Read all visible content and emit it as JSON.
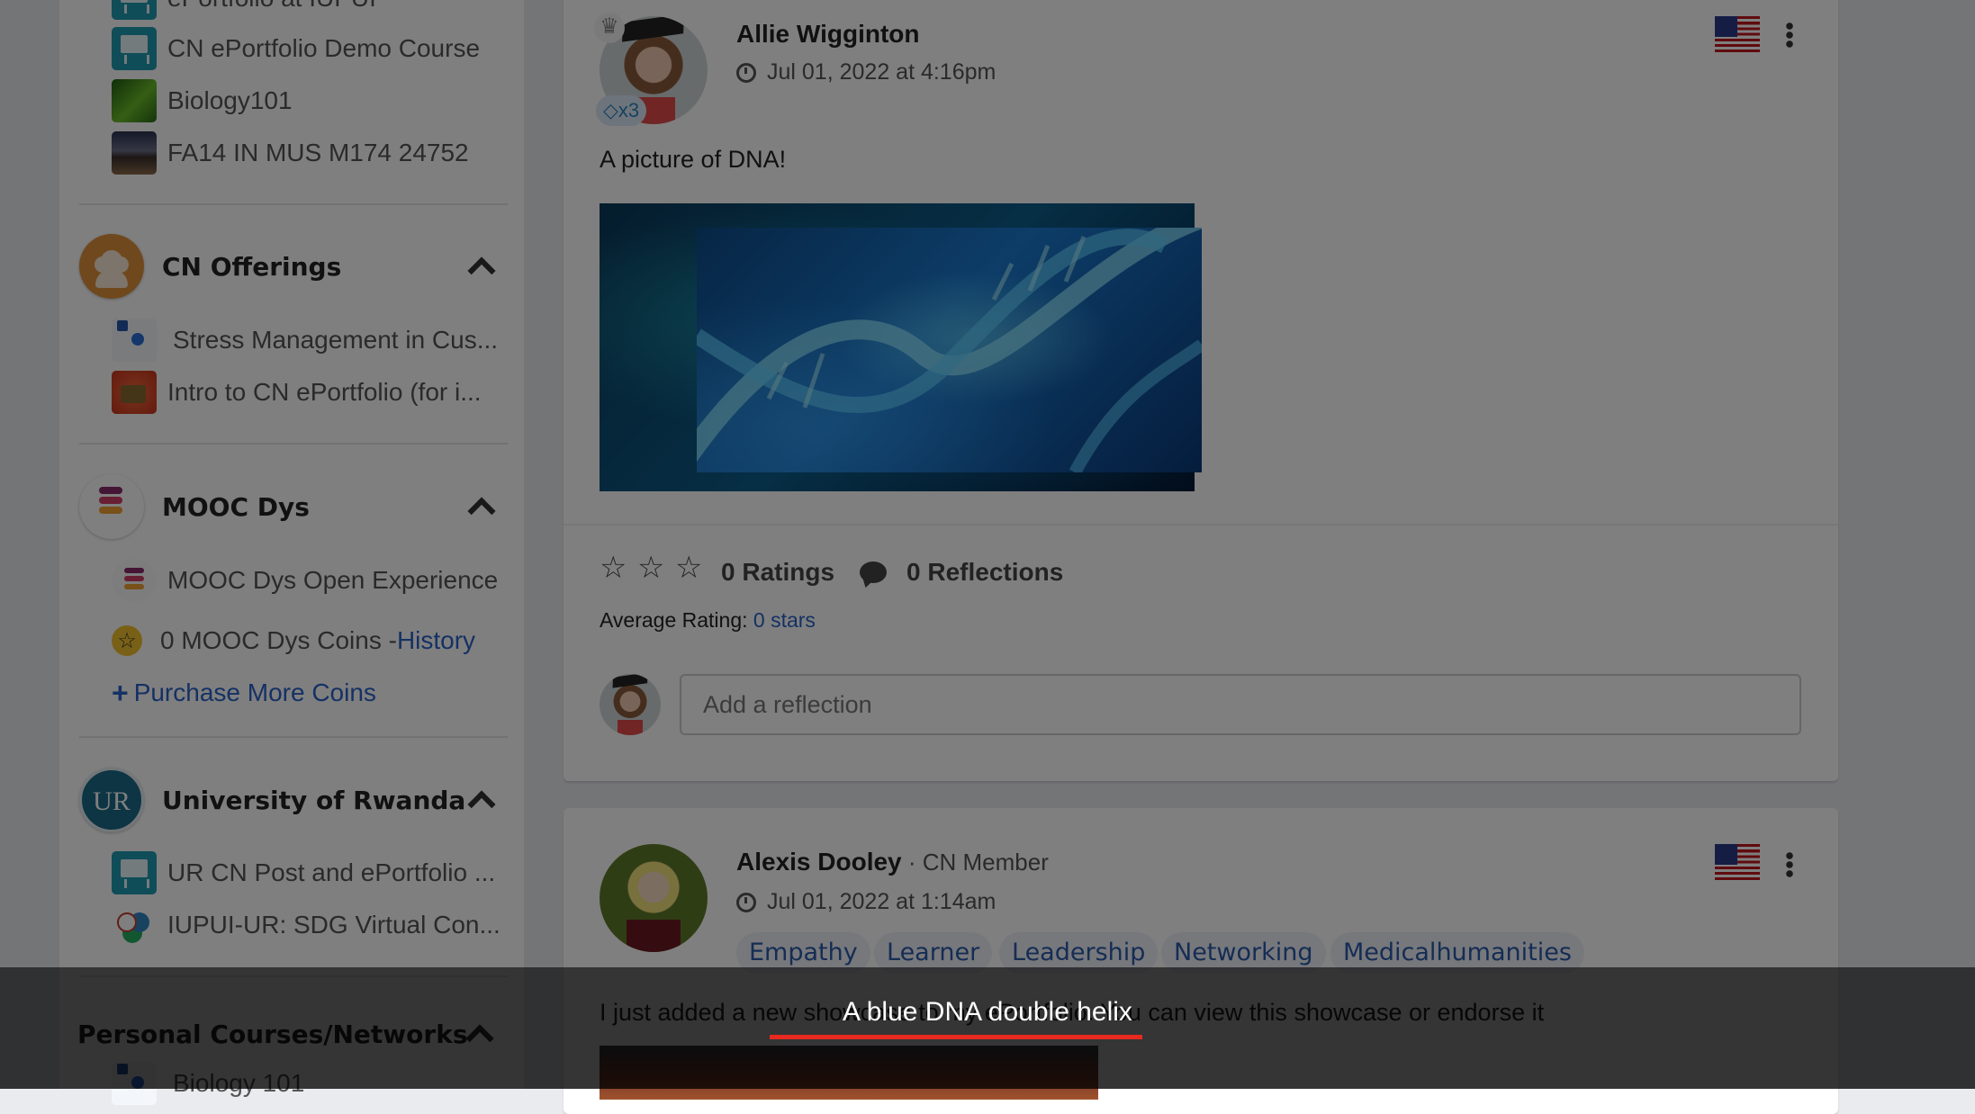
{
  "sidebar": {
    "top_items": [
      {
        "label": "ePortfolio at IUPUI",
        "icon": "easel-icon"
      },
      {
        "label": "CN ePortfolio Demo Course",
        "icon": "easel-icon"
      },
      {
        "label": "Biology101",
        "icon": "dna-thumb-icon"
      },
      {
        "label": "FA14 IN MUS M174 24752",
        "icon": "concert-thumb-icon"
      }
    ],
    "groups": [
      {
        "title": "CN Offerings",
        "logo": "people-icon",
        "items": [
          {
            "label": "Stress Management in Cus..."
          },
          {
            "label": "Intro to CN ePortfolio (for i..."
          }
        ]
      },
      {
        "title": "MOOC Dys",
        "logo": "mooc-dys-logo",
        "items": [
          {
            "label": "MOOC Dys Open Experience"
          }
        ],
        "coins": {
          "text": "0 MOOC Dys Coins - ",
          "history_link": "History"
        },
        "purchase": {
          "plus": "+",
          "label": "Purchase More Coins"
        }
      },
      {
        "title": "University of Rwanda",
        "logo": "ur-logo",
        "logo_text": "UR",
        "items": [
          {
            "label": "UR CN Post and ePortfolio ..."
          },
          {
            "label": "IUPUI-UR: SDG Virtual Con..."
          }
        ]
      },
      {
        "title": "Personal Courses/Networks",
        "items": [
          {
            "label": "Biology 101"
          }
        ]
      }
    ]
  },
  "feed": {
    "posts": [
      {
        "author": "Allie Wigginton",
        "timestamp": "Jul 01, 2022 at 4:16pm",
        "badge": "x3",
        "crown": "♛",
        "text": "A picture of DNA!",
        "image_alt": "A blue DNA double helix",
        "ratings_label": "0 Ratings",
        "reflections_label": "0 Reflections",
        "average_rating_label": "Average Rating: ",
        "average_rating_value": "0 stars",
        "reflection_placeholder": "Add a reflection",
        "stars": [
          "☆",
          "☆",
          "☆"
        ]
      },
      {
        "author": "Alexis Dooley",
        "role": " · CN Member",
        "timestamp": "Jul 01, 2022 at 1:14am",
        "tags": [
          "Empathy",
          "Learner",
          "Leadership",
          "Networking",
          "Medicalhumanities"
        ],
        "text": "I just added a new showcase to my ePortfolio. You can view this showcase or endorse it"
      }
    ]
  },
  "overlay": {
    "caption": "A blue DNA double helix"
  },
  "colors": {
    "link": "#2a62c9",
    "tag_text": "#2a5aa8",
    "caption_underline": "#e8291f",
    "badge": "#2e86c1"
  }
}
